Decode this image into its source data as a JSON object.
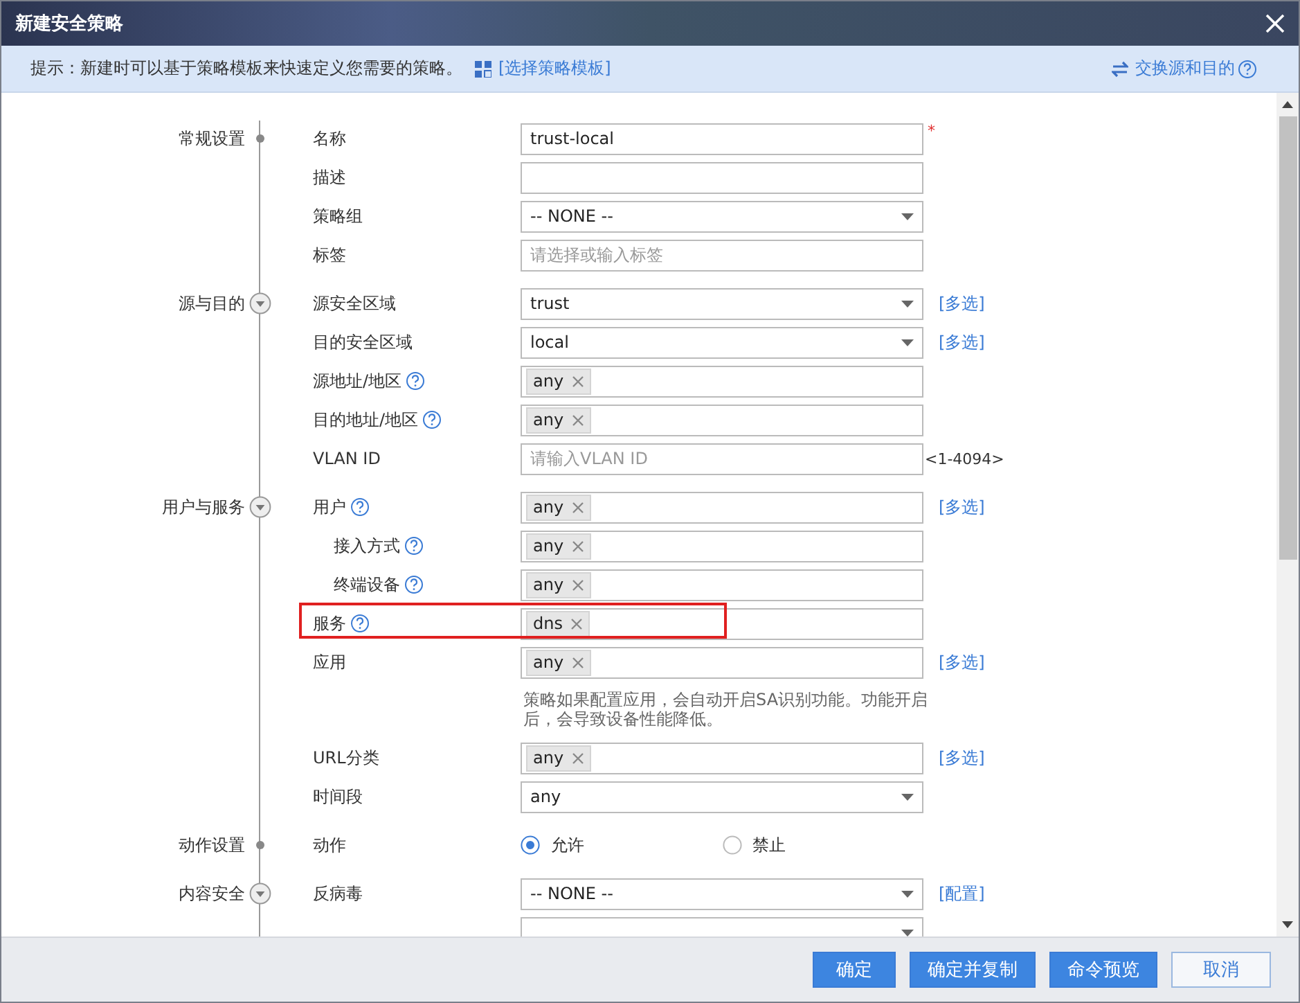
{
  "window": {
    "title": "新建安全策略"
  },
  "hint": {
    "text": "提示：新建时可以基于策略模板来快速定义您需要的策略。",
    "link": "[选择策略模板]",
    "swap": "交换源和目的"
  },
  "sections": [
    {
      "label": "常规设置",
      "kind": "dot",
      "fields": [
        {
          "label": "名称",
          "kind": "text",
          "value": "trust-local",
          "required_mark": "*"
        },
        {
          "label": "描述",
          "kind": "text"
        },
        {
          "label": "策略组",
          "kind": "select",
          "value": "-- NONE --"
        },
        {
          "label": "标签",
          "kind": "text",
          "placeholder": "请选择或输入标签"
        }
      ]
    },
    {
      "label": "源与目的",
      "kind": "toggle",
      "fields": [
        {
          "label": "源安全区域",
          "kind": "select",
          "value": "trust",
          "link": "[多选]"
        },
        {
          "label": "目的安全区域",
          "kind": "select",
          "value": "local",
          "link": "[多选]"
        },
        {
          "label": "源地址/地区",
          "kind": "tags",
          "help": true,
          "tags": [
            "any"
          ]
        },
        {
          "label": "目的地址/地区",
          "kind": "tags",
          "help": true,
          "tags": [
            "any"
          ]
        },
        {
          "label": "VLAN ID",
          "kind": "text",
          "placeholder": "请输入VLAN ID",
          "suffix": "<1-4094>"
        }
      ]
    },
    {
      "label": "用户与服务",
      "kind": "toggle",
      "fields": [
        {
          "label": "用户",
          "kind": "tags",
          "help": true,
          "tags": [
            "any"
          ],
          "link": "[多选]"
        },
        {
          "label": "接入方式",
          "kind": "tags",
          "help": true,
          "indent": true,
          "tags": [
            "any"
          ]
        },
        {
          "label": "终端设备",
          "kind": "tags",
          "help": true,
          "indent": true,
          "tags": [
            "any"
          ]
        },
        {
          "label": "服务",
          "kind": "tags",
          "help": true,
          "tags": [
            "dns"
          ],
          "highlighted": true
        },
        {
          "label": "应用",
          "kind": "tags",
          "tags": [
            "any"
          ],
          "link": "[多选]",
          "note": "策略如果配置应用，会自动开启SA识别功能。功能开启后，会导致设备性能降低。"
        },
        {
          "label": "URL分类",
          "kind": "tags",
          "tags": [
            "any"
          ],
          "link": "[多选]"
        },
        {
          "label": "时间段",
          "kind": "select",
          "value": "any"
        }
      ]
    },
    {
      "label": "动作设置",
      "kind": "dot",
      "fields": [
        {
          "label": "动作",
          "kind": "radio",
          "options": [
            {
              "label": "允许",
              "selected": true
            },
            {
              "label": "禁止",
              "selected": false
            }
          ]
        }
      ]
    },
    {
      "label": "内容安全",
      "kind": "toggle",
      "fields": [
        {
          "label": "反病毒",
          "kind": "select",
          "value": "-- NONE --",
          "link": "[配置]"
        },
        {
          "kind": "select"
        }
      ]
    }
  ],
  "buttons": [
    {
      "label": "确定",
      "kind": "primary"
    },
    {
      "label": "确定并复制",
      "kind": "primary"
    },
    {
      "label": "命令预览",
      "kind": "primary"
    },
    {
      "label": "取消",
      "kind": "secondary"
    }
  ]
}
